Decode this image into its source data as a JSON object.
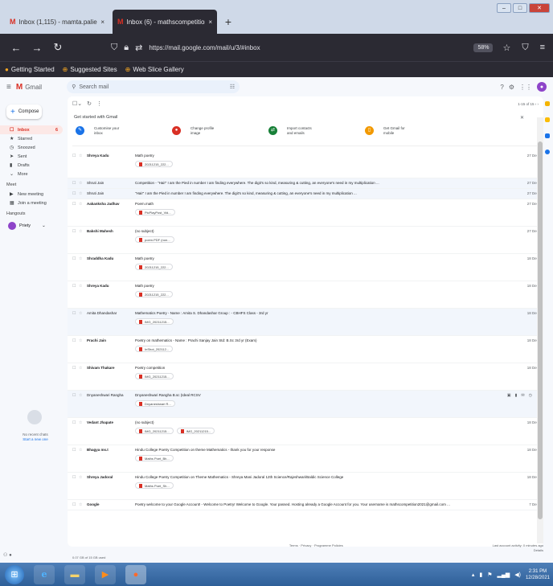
{
  "browser": {
    "tabs": [
      {
        "favicon": "M",
        "label": "Inbox (1,115) - mamta.paliespa...",
        "close": "×"
      },
      {
        "favicon": "M",
        "label": "Inbox (6) - mathscompetition2...",
        "close": "×"
      }
    ],
    "new_tab": "+",
    "url": "https://mail.google.com/mail/u/3/#inbox",
    "zoom": "58%",
    "bookmarks": [
      "Getting Started",
      "Suggested Sites",
      "Web Slice Gallery"
    ]
  },
  "gmail": {
    "logo_text": "Gmail",
    "search_placeholder": "Search mail",
    "compose": "Compose",
    "nav": [
      {
        "icon": "☐",
        "label": "Inbox",
        "count": "6",
        "active": true
      },
      {
        "icon": "★",
        "label": "Starred",
        "count": ""
      },
      {
        "icon": "◷",
        "label": "Snoozed",
        "count": ""
      },
      {
        "icon": "➤",
        "label": "Sent",
        "count": ""
      },
      {
        "icon": "▮",
        "label": "Drafts",
        "count": ""
      },
      {
        "icon": "⌄",
        "label": "More",
        "count": ""
      }
    ],
    "meet": {
      "heading": "Meet",
      "items": [
        {
          "icon": "▶",
          "label": "New meeting"
        },
        {
          "icon": "▦",
          "label": "Join a meeting"
        }
      ]
    },
    "hangouts": {
      "heading": "Hangouts",
      "user": "Priety",
      "empty_text": "No recent chats",
      "empty_link": "Start a new one"
    },
    "getting_started": {
      "title": "Get started with Gmail",
      "items": [
        {
          "icon": "✎",
          "color": "#1a73e8",
          "line1": "Customise your",
          "line2": "inbox"
        },
        {
          "icon": "●",
          "color": "#d93025",
          "line1": "Change profile",
          "line2": "image"
        },
        {
          "icon": "⇄",
          "color": "#188038",
          "line1": "Import contacts",
          "line2": "and emails"
        },
        {
          "icon": "▯",
          "color": "#f29900",
          "line1": "Get Gmail for",
          "line2": "mobile"
        }
      ]
    },
    "pager": "1-15 of 15",
    "emails": [
      {
        "sender": "Shreya Kadu",
        "subject": "Math poetry",
        "date": "27 Dec",
        "chips": [
          "20211215_222..."
        ],
        "read": false
      },
      {
        "sender": "Shruti Jain",
        "subject": "Competition - \"Hai!\" I am the Pied in number I am finding everywhere. The digit's so kind, measuring & cutting, an everyone's need in my multiplication ...",
        "date": "27 Dec",
        "chips": [],
        "read": true
      },
      {
        "sender": "Shruti Jain",
        "subject": "\"Hai!\" I am the Pied in number I am finding everywhere. The digit's so kind, measuring & cutting, an everyone's need in my multiplication ...",
        "date": "27 Dec",
        "chips": [],
        "read": true
      },
      {
        "sender": "Aakanksha Jadhav",
        "subject": "Poem.math",
        "date": "27 Dec",
        "chips": [
          "PicPlayPost_Vid..."
        ],
        "read": false
      },
      {
        "sender": "Bakshi Mahesh",
        "subject": "(no subject)",
        "date": "27 Dec",
        "chips": [
          "poem.PDF (non..."
        ],
        "read": false
      },
      {
        "sender": "Shraddha Kadu",
        "subject": "Math poetry",
        "date": "18 Dec",
        "chips": [
          "20211215_222..."
        ],
        "read": false
      },
      {
        "sender": "Shreya Kadu",
        "subject": "Math poetry",
        "date": "18 Dec",
        "chips": [
          "20211215_222..."
        ],
        "read": false
      },
      {
        "sender": "Amita Dhandashar",
        "subject": "Mathematics Poetry - Name : Amita S. Dhandashar Group : - CBHFS Class - 3rd yr",
        "date": "18 Dec",
        "chips": [
          "IMG_20211215..."
        ],
        "read": true
      },
      {
        "sender": "Prachi Jain",
        "subject": "Poetry on mathematics - Name : Prachi Sanjay Jain Std: B.Sc 3rd yr (Exam)",
        "date": "18 Dec",
        "chips": [
          "InShot_202112..."
        ],
        "read": false
      },
      {
        "sender": "Shivam Thakare",
        "subject": "Poetry competition",
        "date": "18 Dec",
        "chips": [
          "IMG_20211215..."
        ],
        "read": false
      },
      {
        "sender": "Dnyaneshwari Rangha",
        "subject": "Dnyaneshwari Rangha B.sc (Ideal RCSV",
        "date": "",
        "chips": [
          "Dnyaneshwari R..."
        ],
        "read": true,
        "hover": true
      },
      {
        "sender": "Vedant Jhapate",
        "subject": "(no subject)",
        "date": "18 Dec",
        "chips": [
          "IMG_20211215...",
          "IMG_20211215..."
        ],
        "read": false
      },
      {
        "sender": "Bhagya ms.t",
        "subject": "Hindu College Poetry Competition on theme Mathematics - thank you for your response",
        "date": "18 Dec",
        "chips": [
          "Maths Poet_Bh..."
        ],
        "read": false
      },
      {
        "sender": "Shreya Jadoral",
        "subject": "Hindu College Poetry Competition on Theme Mathematics - Shreya Mani Jadoral 12th Science/Rajeshwari/Baldic Science College",
        "date": "18 Dec",
        "chips": [
          "Maths Poet_Sh..."
        ],
        "read": false
      },
      {
        "sender": "Google",
        "subject": "Poetry welcome to your Google Account! - Welcome to Poetry! Welcome to Google. Your passed. Hosting already a Google Account for you. Your username is mathscompetition2021@gmail.com ...",
        "date": "7 Dec",
        "chips": [],
        "read": false
      }
    ],
    "footer": {
      "storage": "0.07 GB of 15 GB used",
      "terms": "Terms · Privacy · Programme Policies",
      "activity": "Last account activity: 0 minutes ago",
      "details": "Details"
    }
  },
  "taskbar": {
    "time": "2:31 PM",
    "date": "12/28/2021"
  }
}
